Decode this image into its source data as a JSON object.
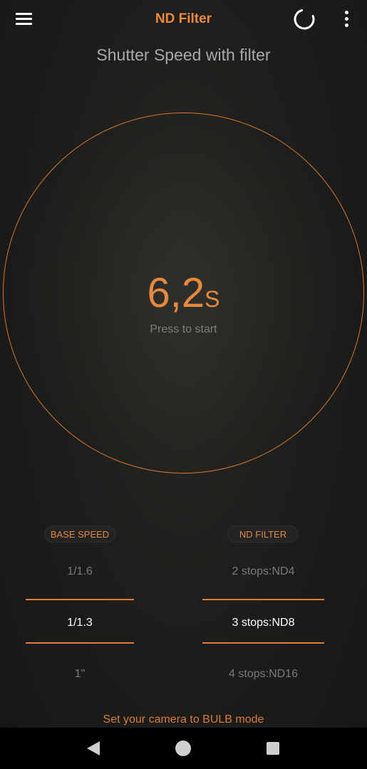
{
  "header": {
    "title": "ND Filter",
    "menu_icon": "hamburger-menu-icon",
    "refresh_icon": "refresh-icon",
    "overflow_icon": "more-vert-icon"
  },
  "subtitle": "Shutter Speed with filter",
  "timer": {
    "value": "6,2",
    "unit": "S",
    "hint": "Press to start"
  },
  "pickers": {
    "base_speed": {
      "label": "BASE SPEED",
      "items": [
        "1/1.6",
        "1/1.3",
        "1\""
      ],
      "selected": "1/1.3"
    },
    "nd_filter": {
      "label": "ND FILTER",
      "items": [
        "2 stops:ND4",
        "3 stops:ND8",
        "4 stops:ND16"
      ],
      "selected": "3 stops:ND8"
    }
  },
  "footer": {
    "note": "Set your camera to BULB mode"
  },
  "navbar": {
    "back_icon": "back-triangle-icon",
    "home_icon": "home-circle-icon",
    "recents_icon": "recents-square-icon"
  },
  "colors": {
    "accent": "#ee8a3a",
    "background": "#1e1e1c",
    "selected_text": "#ffffff",
    "dim_text": "#7a7a7a"
  }
}
